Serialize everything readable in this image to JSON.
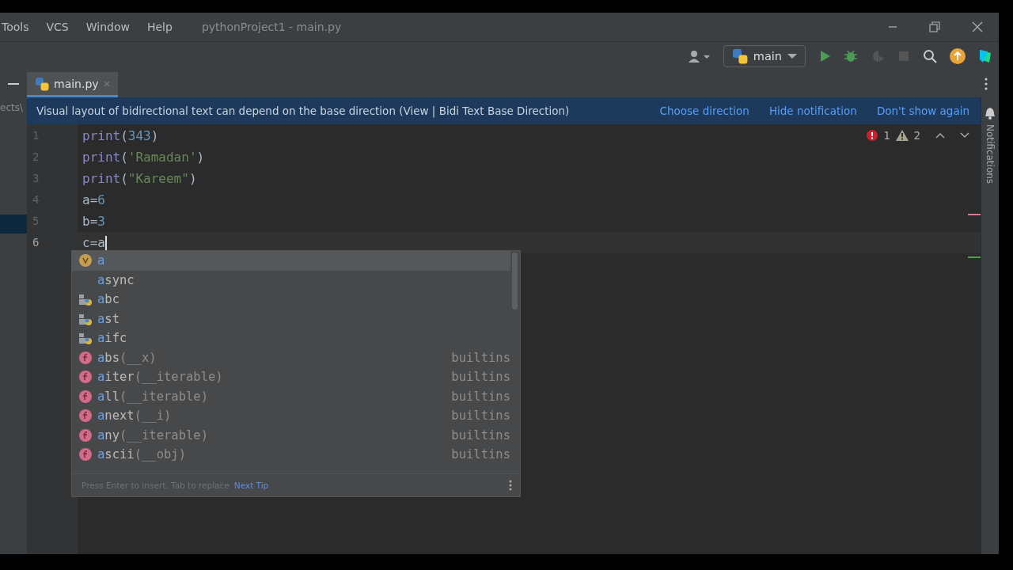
{
  "menu": [
    "Tools",
    "VCS",
    "Window",
    "Help"
  ],
  "window": {
    "title": "pythonProject1 - main.py"
  },
  "toolbar": {
    "branch": "main"
  },
  "project_panel": {
    "path": "ects\\"
  },
  "tabs": [
    {
      "label": "main.py",
      "selected": true
    }
  ],
  "notification": {
    "text": "Visual layout of bidirectional text can depend on the base direction (View | Bidi Text Base Direction)",
    "actions": [
      "Choose direction",
      "Hide notification",
      "Don't show again"
    ]
  },
  "editor": {
    "lines": [
      {
        "number": "1",
        "current": false,
        "tokens": [
          {
            "kind": "builtin",
            "text": "print"
          },
          {
            "kind": "plain",
            "text": "("
          },
          {
            "kind": "number",
            "text": "343"
          },
          {
            "kind": "plain",
            "text": ")"
          }
        ]
      },
      {
        "number": "2",
        "current": false,
        "tokens": [
          {
            "kind": "builtin",
            "text": "print"
          },
          {
            "kind": "plain",
            "text": "("
          },
          {
            "kind": "string",
            "text": "'Ramadan'"
          },
          {
            "kind": "plain",
            "text": ")"
          }
        ]
      },
      {
        "number": "3",
        "current": false,
        "tokens": [
          {
            "kind": "builtin",
            "text": "print"
          },
          {
            "kind": "plain",
            "text": "("
          },
          {
            "kind": "string",
            "text": "\"Kareem\""
          },
          {
            "kind": "plain",
            "text": ")"
          }
        ]
      },
      {
        "number": "4",
        "current": false,
        "tokens": [
          {
            "kind": "plain",
            "text": "a="
          },
          {
            "kind": "number",
            "text": "6"
          }
        ]
      },
      {
        "number": "5",
        "current": false,
        "tokens": [
          {
            "kind": "plain",
            "text": "b="
          },
          {
            "kind": "number",
            "text": "3"
          }
        ]
      },
      {
        "number": "6",
        "current": true,
        "tokens": [
          {
            "kind": "plain",
            "text": "c=a"
          }
        ]
      }
    ],
    "errors": "1",
    "warnings": "2"
  },
  "completion": {
    "items": [
      {
        "kind": "variable",
        "typed": "a",
        "selected": true
      },
      {
        "kind": "keyword",
        "typed": "a",
        "rest": "sync",
        "selected": false
      },
      {
        "kind": "module",
        "typed": "a",
        "rest": "bc",
        "selected": false
      },
      {
        "kind": "module",
        "typed": "a",
        "rest": "st",
        "selected": false
      },
      {
        "kind": "module",
        "typed": "a",
        "rest": "ifc",
        "selected": false
      },
      {
        "kind": "function",
        "typed": "a",
        "rest": "bs",
        "params": "(__x)",
        "source": "builtins",
        "selected": false
      },
      {
        "kind": "function",
        "typed": "a",
        "rest": "iter",
        "params": "(__iterable)",
        "source": "builtins",
        "selected": false
      },
      {
        "kind": "function",
        "typed": "a",
        "rest": "ll",
        "params": "(__iterable)",
        "source": "builtins",
        "selected": false
      },
      {
        "kind": "function",
        "typed": "a",
        "rest": "next",
        "params": "(__i)",
        "source": "builtins",
        "selected": false
      },
      {
        "kind": "function",
        "typed": "a",
        "rest": "ny",
        "params": "(__iterable)",
        "source": "builtins",
        "selected": false
      },
      {
        "kind": "function",
        "typed": "a",
        "rest": "scii",
        "params": "(__obj)",
        "source": "builtins",
        "selected": false
      }
    ],
    "hint": "Press Enter to insert, Tab to replace",
    "tip_link": "Next Tip"
  },
  "side_stripe": {
    "label": "Notifications"
  }
}
